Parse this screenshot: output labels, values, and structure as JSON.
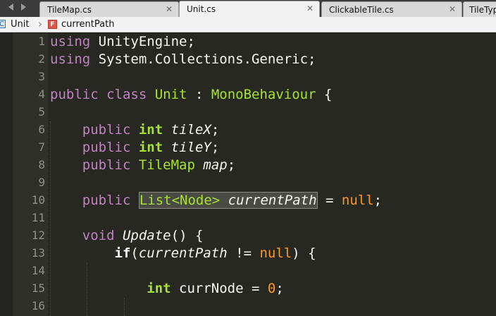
{
  "tabs": [
    {
      "label": "TileMap.cs",
      "close": "✕"
    },
    {
      "label": "Unit.cs",
      "close": "✕"
    },
    {
      "label": "ClickableTile.cs",
      "close": "✕"
    },
    {
      "label": "TileTyp"
    }
  ],
  "breadcrumb": {
    "class_icon_text": "C",
    "class_label": "Unit",
    "separator": "›",
    "field_icon_text": "F",
    "field_label": "currentPath"
  },
  "line_numbers": [
    "1",
    "2",
    "3",
    "4",
    "5",
    "6",
    "7",
    "8",
    "9",
    "10",
    "11",
    "12",
    "13",
    "14",
    "15",
    "16"
  ],
  "code": {
    "l1": {
      "kw": "using",
      "rest": " UnityEngine;"
    },
    "l2": {
      "kw": "using",
      "rest": " System.Collections.Generic;"
    },
    "l4": {
      "kw": "public class",
      "name": "Unit",
      "colon": " : ",
      "base": "MonoBehaviour",
      "brace": " {"
    },
    "l6": {
      "indent": "    ",
      "kw": "public",
      "type": "int",
      "name": "tileX",
      "semi": ";"
    },
    "l7": {
      "indent": "    ",
      "kw": "public",
      "type": "int",
      "name": "tileY",
      "semi": ";"
    },
    "l8": {
      "indent": "    ",
      "kw": "public",
      "type": "TileMap",
      "name": "map",
      "semi": ";"
    },
    "l10": {
      "indent": "    ",
      "kw": "public",
      "sel_type": "List<Node>",
      "sel_name": "currentPath",
      "eq": " = ",
      "null": "null",
      "semi": ";"
    },
    "l12": {
      "indent": "    ",
      "kw": "void",
      "name": "Update",
      "rest": "() {"
    },
    "l13": {
      "indent": "        ",
      "kw": "if",
      "open": "(",
      "name": "currentPath",
      "op": " != ",
      "null": "null",
      "rest": ") {"
    },
    "l15": {
      "indent": "            ",
      "type": "int",
      "rest": " currNode = ",
      "num": "0",
      "semi": ";"
    }
  }
}
